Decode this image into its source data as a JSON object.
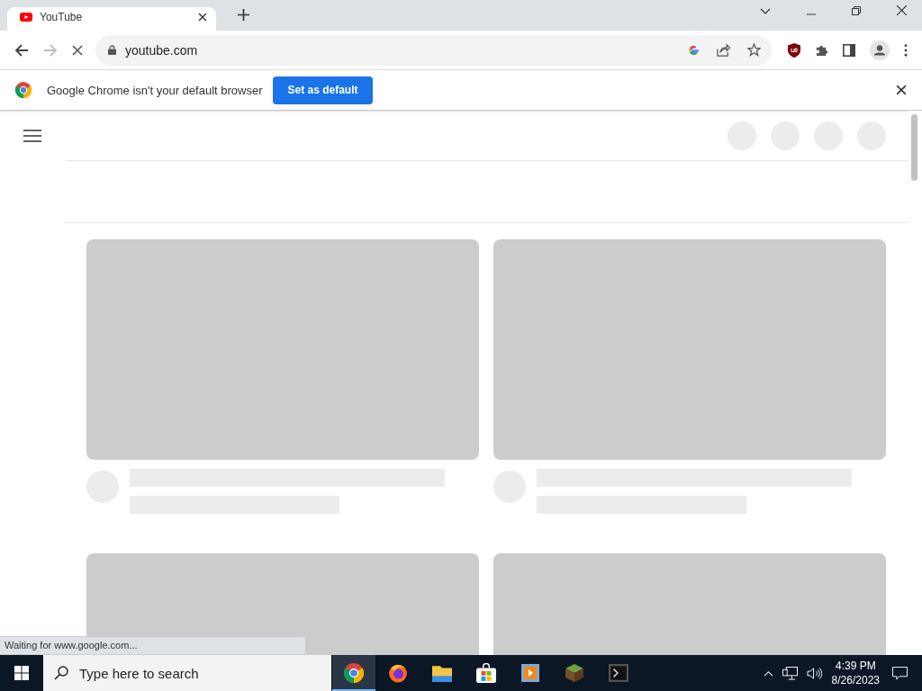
{
  "tab": {
    "title": "YouTube",
    "selected": true
  },
  "address": {
    "url": "youtube.com"
  },
  "infobar": {
    "message": "Google Chrome isn't your default browser",
    "button": "Set as default"
  },
  "page": {
    "loading_cards": [
      {
        "kind": "skeleton"
      },
      {
        "kind": "skeleton"
      },
      {
        "kind": "thumbnail_only"
      },
      {
        "kind": "thumbnail_only"
      }
    ]
  },
  "status_bubble": "Waiting for www.google.com...",
  "taskbar": {
    "search_placeholder": "Type here to search",
    "apps": [
      {
        "kind": "chrome",
        "selected": true
      },
      {
        "kind": "firefox",
        "selected": false
      },
      {
        "kind": "folder",
        "selected": false
      },
      {
        "kind": "store",
        "selected": false
      },
      {
        "kind": "media",
        "selected": false
      },
      {
        "kind": "block",
        "selected": false
      },
      {
        "kind": "terminal",
        "selected": false
      }
    ],
    "time": "4:39 PM",
    "date": "8/26/2023"
  }
}
